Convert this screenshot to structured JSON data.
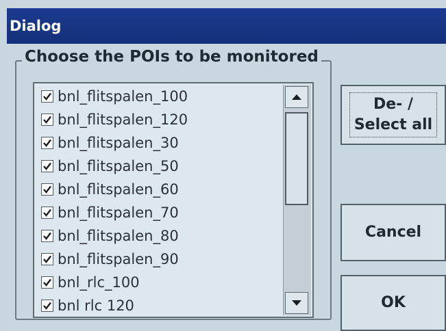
{
  "window": {
    "title": "Dialog"
  },
  "group": {
    "legend": "Choose the POIs to be monitored"
  },
  "list": {
    "items": [
      {
        "label": "bnl_flitspalen_100",
        "checked": true
      },
      {
        "label": "bnl_flitspalen_120",
        "checked": true
      },
      {
        "label": "bnl_flitspalen_30",
        "checked": true
      },
      {
        "label": "bnl_flitspalen_50",
        "checked": true
      },
      {
        "label": "bnl_flitspalen_60",
        "checked": true
      },
      {
        "label": "bnl_flitspalen_70",
        "checked": true
      },
      {
        "label": "bnl_flitspalen_80",
        "checked": true
      },
      {
        "label": "bnl_flitspalen_90",
        "checked": true
      },
      {
        "label": "bnl_rlc_100",
        "checked": true
      },
      {
        "label": "bnl rlc 120",
        "checked": true
      }
    ]
  },
  "buttons": {
    "select_all": "De- /\nSelect all",
    "cancel": "Cancel",
    "ok": "OK"
  },
  "icons": {
    "scroll_up": "triangle-up-icon",
    "scroll_down": "triangle-down-icon",
    "checkbox": "checkmark-icon"
  }
}
